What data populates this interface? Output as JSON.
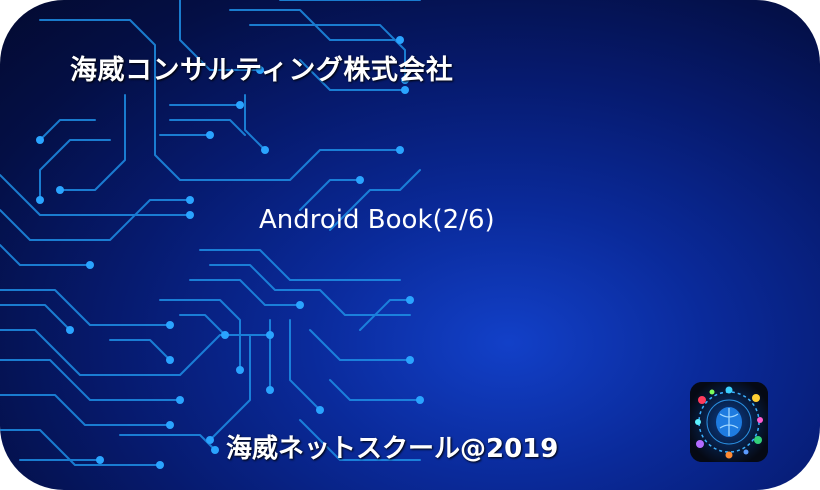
{
  "card": {
    "company_name": "海威コンサルティング株式会社",
    "book_title": "Android Book(2/6)",
    "footer_text": "海威ネットスクール@2019"
  },
  "icons": {
    "logo": "brain-circuit-icon",
    "background": "circuit-board-pattern"
  },
  "colors": {
    "background_dark": "#030a30",
    "background_glow": "#1240c8",
    "circuit_line": "#1e8fe6",
    "text": "#ffffff"
  }
}
